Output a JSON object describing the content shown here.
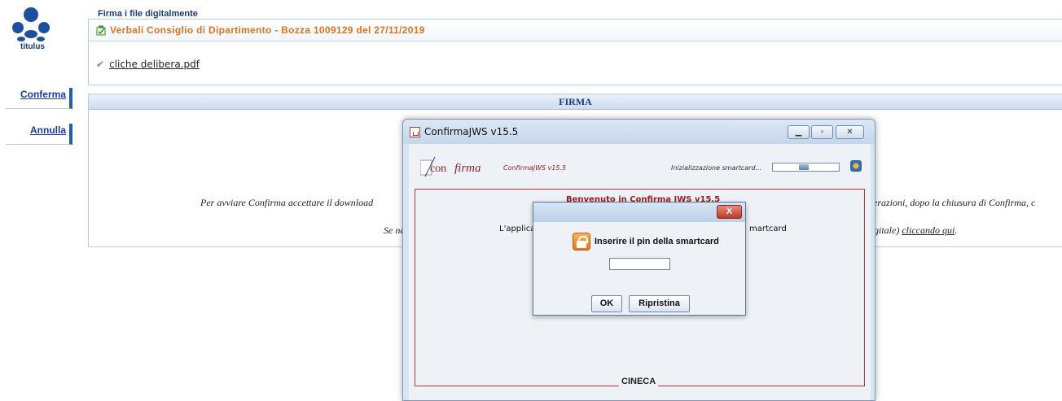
{
  "app": {
    "logo_text": "titulus"
  },
  "sidebar": {
    "confirm_label": "Conferma",
    "cancel_label": "Annulla"
  },
  "page": {
    "title": "Firma i file digitalmente",
    "document_title": "Verbali Consiglio di Dipartimento - Bozza 1009129 del 27/11/2019",
    "file_name": "cliche delibera.pdf"
  },
  "firma": {
    "header": "FIRMA",
    "line1_left": "Per avviare Confirma accettare il download",
    "line1_right": "erazioni, dopo la chiusura di Confirma, c",
    "line2_left": "Se ne",
    "line2_right": "gitale)",
    "line2_link": "cliccando qui",
    "line2_end": "."
  },
  "jws_window": {
    "title": "ConfirmaJWS v15.5",
    "logo_text_con": "con",
    "logo_text_firma": "firma",
    "version_label": "ConfirmaJWS v15.5",
    "init_label": "Inizializzazione smartcard...",
    "progress_fraction": 0.15,
    "frame_heading": "Benvenuto in Confirma JWS v15.5",
    "frame_line_left": "L'applica",
    "frame_line_right": "martcard",
    "footer": "CINECA"
  },
  "pin_dialog": {
    "close_glyph": "X",
    "prompt": "Inserire il pin della smartcard",
    "pin_value": "",
    "ok_label": "OK",
    "reset_label": "Ripristina"
  },
  "icons": {
    "logo": "titulus-dots-logo",
    "document": "document-sign-icon",
    "checkbox": "checkbox-icon",
    "java": "java-cup-icon",
    "settings": "settings-icon",
    "lock": "lock-icon"
  }
}
